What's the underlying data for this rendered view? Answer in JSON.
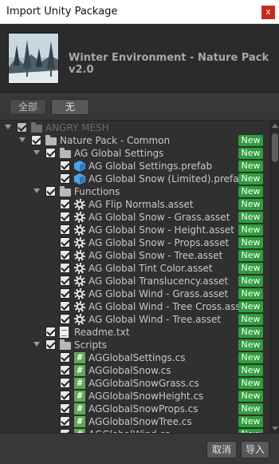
{
  "window": {
    "title": "Import Unity Package",
    "close_glyph": "x"
  },
  "header": {
    "package_title": "Winter Environment - Nature Pack v2.0"
  },
  "selection": {
    "all_label": "全部",
    "none_label": "无"
  },
  "tree": {
    "new_badge": "New",
    "items": [
      {
        "label": "ANGRY MESH",
        "icon": "folder-icon",
        "fold": true,
        "dim": true,
        "new": false
      },
      {
        "label": "Nature Pack - Common",
        "icon": "folder-icon",
        "fold": true,
        "dim": false,
        "new": true
      },
      {
        "label": "AG Global Settings",
        "icon": "folder-icon",
        "fold": true,
        "dim": false,
        "new": true
      },
      {
        "label": "AG Global Settings.prefab",
        "icon": "prefab-icon",
        "fold": false,
        "dim": false,
        "new": true
      },
      {
        "label": "AG Global Snow (Limited).prefab",
        "icon": "prefab-icon",
        "fold": false,
        "dim": false,
        "new": true
      },
      {
        "label": "Functions",
        "icon": "folder-icon",
        "fold": true,
        "dim": false,
        "new": true
      },
      {
        "label": "AG Flip Normals.asset",
        "icon": "asset-icon",
        "fold": false,
        "dim": false,
        "new": true
      },
      {
        "label": "AG Global Snow - Grass.asset",
        "icon": "asset-icon",
        "fold": false,
        "dim": false,
        "new": true
      },
      {
        "label": "AG Global Snow - Height.asset",
        "icon": "asset-icon",
        "fold": false,
        "dim": false,
        "new": true
      },
      {
        "label": "AG Global Snow - Props.asset",
        "icon": "asset-icon",
        "fold": false,
        "dim": false,
        "new": true
      },
      {
        "label": "AG Global Snow - Tree.asset",
        "icon": "asset-icon",
        "fold": false,
        "dim": false,
        "new": true
      },
      {
        "label": "AG Global Tint Color.asset",
        "icon": "asset-icon",
        "fold": false,
        "dim": false,
        "new": true
      },
      {
        "label": "AG Global Translucency.asset",
        "icon": "asset-icon",
        "fold": false,
        "dim": false,
        "new": true
      },
      {
        "label": "AG Global Wind - Grass.asset",
        "icon": "asset-icon",
        "fold": false,
        "dim": false,
        "new": true
      },
      {
        "label": "AG Global Wind - Tree Cross.asset",
        "icon": "asset-icon",
        "fold": false,
        "dim": false,
        "new": true
      },
      {
        "label": "AG Global Wind - Tree.asset",
        "icon": "asset-icon",
        "fold": false,
        "dim": false,
        "new": true
      },
      {
        "label": "Readme.txt",
        "icon": "text-file-icon",
        "fold": false,
        "dim": false,
        "new": true
      },
      {
        "label": "Scripts",
        "icon": "folder-icon",
        "fold": true,
        "dim": false,
        "new": true
      },
      {
        "label": "AGGlobalSettings.cs",
        "icon": "csharp-script-icon",
        "fold": false,
        "dim": false,
        "new": true
      },
      {
        "label": "AGGlobalSnow.cs",
        "icon": "csharp-script-icon",
        "fold": false,
        "dim": false,
        "new": true
      },
      {
        "label": "AGGlobalSnowGrass.cs",
        "icon": "csharp-script-icon",
        "fold": false,
        "dim": false,
        "new": true
      },
      {
        "label": "AGGlobalSnowHeight.cs",
        "icon": "csharp-script-icon",
        "fold": false,
        "dim": false,
        "new": true
      },
      {
        "label": "AGGlobalSnowProps.cs",
        "icon": "csharp-script-icon",
        "fold": false,
        "dim": false,
        "new": true
      },
      {
        "label": "AGGlobalSnowTree.cs",
        "icon": "csharp-script-icon",
        "fold": false,
        "dim": false,
        "new": true
      },
      {
        "label": "AGGlobalWind.cs",
        "icon": "csharp-script-icon",
        "fold": false,
        "dim": false,
        "new": true
      }
    ]
  },
  "footer": {
    "cancel_label": "取消",
    "import_label": "导入"
  },
  "colors": {
    "new_badge": "#2f9e3c",
    "prefab": "#4fa3e8",
    "script": "#5fa85a",
    "close": "#c42b1c"
  }
}
